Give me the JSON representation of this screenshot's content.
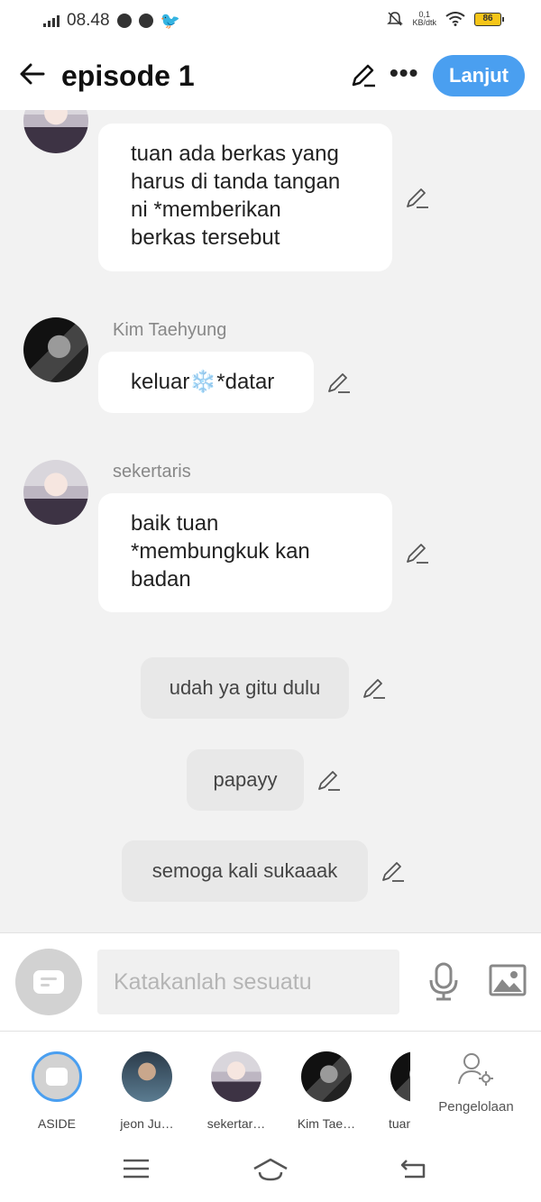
{
  "status_bar": {
    "time": "08.48",
    "net_speed_value": "0,1",
    "net_speed_unit": "KB/dtk",
    "battery": "86",
    "icons": [
      "telegram-icon",
      "spotify-icon",
      "twitter-icon",
      "mute-icon",
      "wifi-icon",
      "battery-icon"
    ]
  },
  "header": {
    "title": "episode 1",
    "next_label": "Lanjut",
    "accent_color": "#4a9ff0"
  },
  "messages": [
    {
      "type": "character",
      "sender": "",
      "avatar": "sekertaris",
      "text_lines": [
        "tuan ada berkas yang",
        "harus di tanda tangan",
        "ni *memberikan",
        "berkas tersebut"
      ]
    },
    {
      "type": "character",
      "sender": "Kim Taehyung",
      "avatar": "kim",
      "text": "keluar❄️*datar"
    },
    {
      "type": "character",
      "sender": "sekertaris",
      "avatar": "sekertaris",
      "text_lines": [
        "baik tuan",
        "*membungkuk kan",
        "badan"
      ]
    },
    {
      "type": "aside",
      "text": "udah ya gitu dulu"
    },
    {
      "type": "aside",
      "text": "papayy"
    },
    {
      "type": "aside",
      "text": "semoga kali sukaaak"
    }
  ],
  "input": {
    "placeholder": "Katakanlah sesuatu"
  },
  "characters": [
    {
      "label": "ASIDE",
      "selected": true
    },
    {
      "label": "jeon Ju…"
    },
    {
      "label": "sekertar…"
    },
    {
      "label": "Kim Tae…"
    },
    {
      "label": "tuan"
    }
  ],
  "manage_label": "Pengelolaan"
}
